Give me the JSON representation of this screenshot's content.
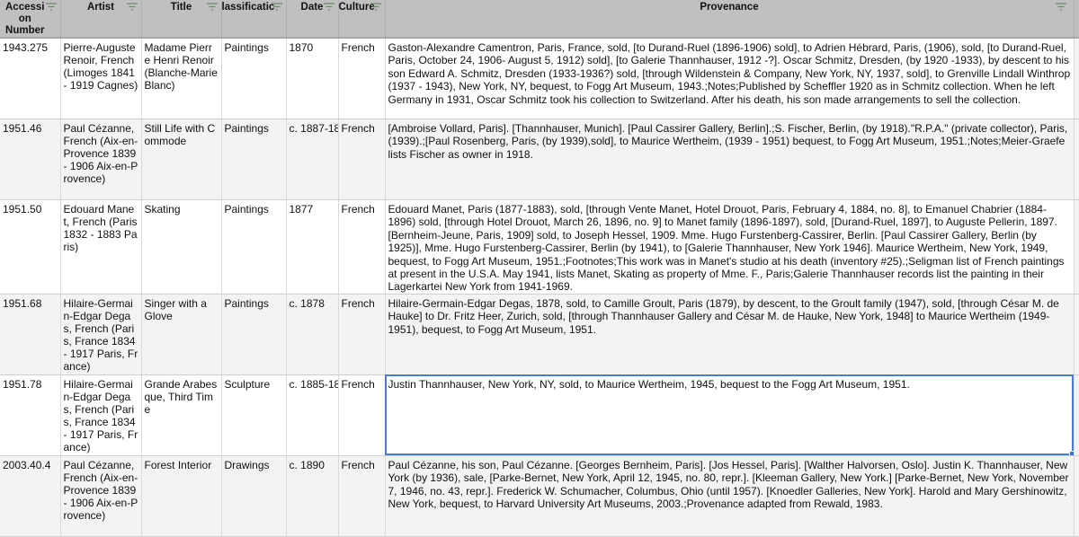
{
  "columns": [
    {
      "label": "Accessi on Number",
      "filter_icon": "filter-icon"
    },
    {
      "label": "Artist",
      "filter_icon": "filter-icon"
    },
    {
      "label": "Title",
      "filter_icon": "filter-icon"
    },
    {
      "label": "lassificatic",
      "filter_icon": "filter-icon"
    },
    {
      "label": "Date",
      "filter_icon": "filter-icon"
    },
    {
      "label": "Culture",
      "filter_icon": "filter-icon"
    },
    {
      "label": "Provenance",
      "filter_icon": "filter-icon"
    }
  ],
  "rows": [
    {
      "accession": "1943.275",
      "artist": "Pierre-Auguste Renoir, French (Limoges 1841 - 1919 Cagnes)",
      "title": "Madame Pierre Henri Renoir (Blanche-Marie Blanc)",
      "classification": "Paintings",
      "date": "1870",
      "culture": "French",
      "provenance": "Gaston-Alexandre Camentron, Paris, France, sold, [to Durand-Ruel (1896-1906) sold], to Adrien Hébrard, Paris, (1906), sold, [to Durand-Ruel, Paris, October 24, 1906- August 5, 1912) sold], [to Galerie Thannhauser, 1912 -?]. Oscar Schmitz, Dresden, (by 1920 -1933), by descent to his son Edward A. Schmitz, Dresden (1933-1936?) sold, [through Wildenstein & Company, New York, NY, 1937, sold], to Grenville Lindall Winthrop (1937 - 1943), New York, NY, bequest, to Fogg Art Museum, 1943.;Notes;Published by Scheffler 1920 as in Schmitz collection. When he left Germany in 1931, Oscar Schmitz took his collection to Switzerland. After his death, his son made arrangements to sell the collection."
    },
    {
      "accession": "1951.46",
      "artist": "Paul Cézanne, French (Aix-en-Provence 1839 - 1906 Aix-en-Provence)",
      "title": "Still Life with Commode",
      "classification": "Paintings",
      "date": "c. 1887-18",
      "culture": "French",
      "provenance": "[Ambroise Vollard, Paris]. [Thannhauser, Munich]. [Paul Cassirer Gallery, Berlin].;S. Fischer, Berlin, (by 1918).\"R.P.A.\" (private collector), Paris, (1939).;[Paul Rosenberg, Paris, (by 1939),sold], to Maurice Wertheim, (1939 - 1951) bequest, to Fogg Art Museum, 1951.;Notes;Meier-Graefe lists Fischer as owner in 1918."
    },
    {
      "accession": "1951.50",
      "artist": "Edouard Manet, French (Paris 1832 - 1883 Paris)",
      "title": "Skating",
      "classification": "Paintings",
      "date": "1877",
      "culture": "French",
      "provenance": "Edouard Manet, Paris (1877-1883), sold, [through Vente Manet, Hotel Drouot, Paris, February 4, 1884, no. 8], to Emanuel Chabrier (1884-1896) sold, [through Hotel Drouot, March 26, 1896, no. 9] to Manet family (1896-1897), sold, [Durand-Ruel, 1897], to Auguste Pellerin, 1897. [Bernheim-Jeune, Paris, 1909] sold, to Joseph Hessel, 1909. Mme. Hugo Furstenberg-Cassirer, Berlin. [Paul Cassirer Gallery, Berlin (by 1925)], Mme. Hugo Furstenberg-Cassirer, Berlin (by 1941), to [Galerie Thannhauser, New York 1946]. Maurice Wertheim, New York, 1949, bequest, to Fogg Art Museum, 1951.;Footnotes;This work was in Manet's studio at his death (inventory #25).;Seligman list of French paintings at present in the U.S.A. May 1941, lists Manet, Skating as property of Mme. F., Paris;Galerie Thannhauser records list the painting in their Lagerkartei New York from 1941-1969."
    },
    {
      "accession": "1951.68",
      "artist": "Hilaire-Germain-Edgar Degas, French (Paris, France 1834 - 1917 Paris, France)",
      "title": "Singer with a Glove",
      "classification": "Paintings",
      "date": "c. 1878",
      "culture": "French",
      "provenance": "Hilaire-Germain-Edgar Degas, 1878, sold, to Camille Groult, Paris (1879), by descent, to the Groult family (1947), sold, [through César M. de Hauke] to Dr. Fritz Heer, Zurich, sold, [through Thannhauser Gallery and César M. de Hauke, New York, 1948] to Maurice Wertheim (1949-1951), bequest, to Fogg Art Museum, 1951."
    },
    {
      "accession": "1951.78",
      "artist": "Hilaire-Germain-Edgar Degas, French (Paris, France 1834 - 1917 Paris, France)",
      "title": "Grande Arabesque, Third Time",
      "classification": "Sculpture",
      "date": "c. 1885-18",
      "culture": "French",
      "provenance": "Justin Thannhauser, New York, NY, sold, to Maurice Wertheim, 1945, bequest to the Fogg Art Museum, 1951."
    },
    {
      "accession": "2003.40.4",
      "artist": "Paul Cézanne, French (Aix-en-Provence 1839 - 1906 Aix-en-Provence)",
      "title": "Forest Interior",
      "classification": "Drawings",
      "date": "c. 1890",
      "culture": "French",
      "provenance": "Paul Cézanne, his son, Paul Cézanne. [Georges Bernheim, Paris]. [Jos Hessel, Paris]. [Walther Halvorsen, Oslo]. Justin K. Thannhauser, New York (by 1936), sale, [Parke-Bernet, New York, April 12, 1945, no. 80, repr.]. [Kleeman Gallery, New York.] [Parke-Bernet, New York, November 7, 1946, no. 43, repr.]. Frederick W. Schumacher, Columbus, Ohio (until 1957). [Knoedler Galleries, New York]. Harold and Mary Gershinowitz, New York, bequest, to Harvard University Art Museums, 2003.;Provenance adapted from Rewald, 1983."
    }
  ],
  "selected_cell": {
    "row": 4,
    "column": "Provenance"
  },
  "colors": {
    "header_bg": "#c0c0c0",
    "selection": "#4a7dd0",
    "alt_row": "#f3f3f3"
  }
}
